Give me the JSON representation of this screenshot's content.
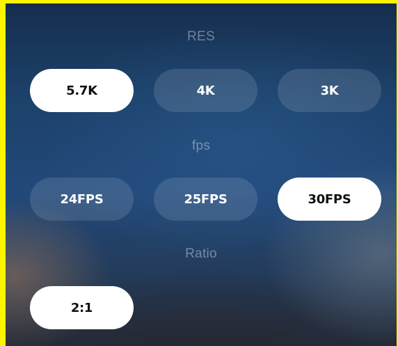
{
  "sections": {
    "res": {
      "title": "RES",
      "options": [
        "5.7K",
        "4K",
        "3K"
      ],
      "selected": "5.7K"
    },
    "fps": {
      "title": "fps",
      "options": [
        "24FPS",
        "25FPS",
        "30FPS"
      ],
      "selected": "30FPS"
    },
    "ratio": {
      "title": "Ratio",
      "options": [
        "2:1"
      ],
      "selected": "2:1"
    }
  },
  "colors": {
    "frame_border": "#fdf400",
    "selected_bg": "#ffffff",
    "selected_text": "#111111",
    "unselected_text": "#ffffff"
  }
}
